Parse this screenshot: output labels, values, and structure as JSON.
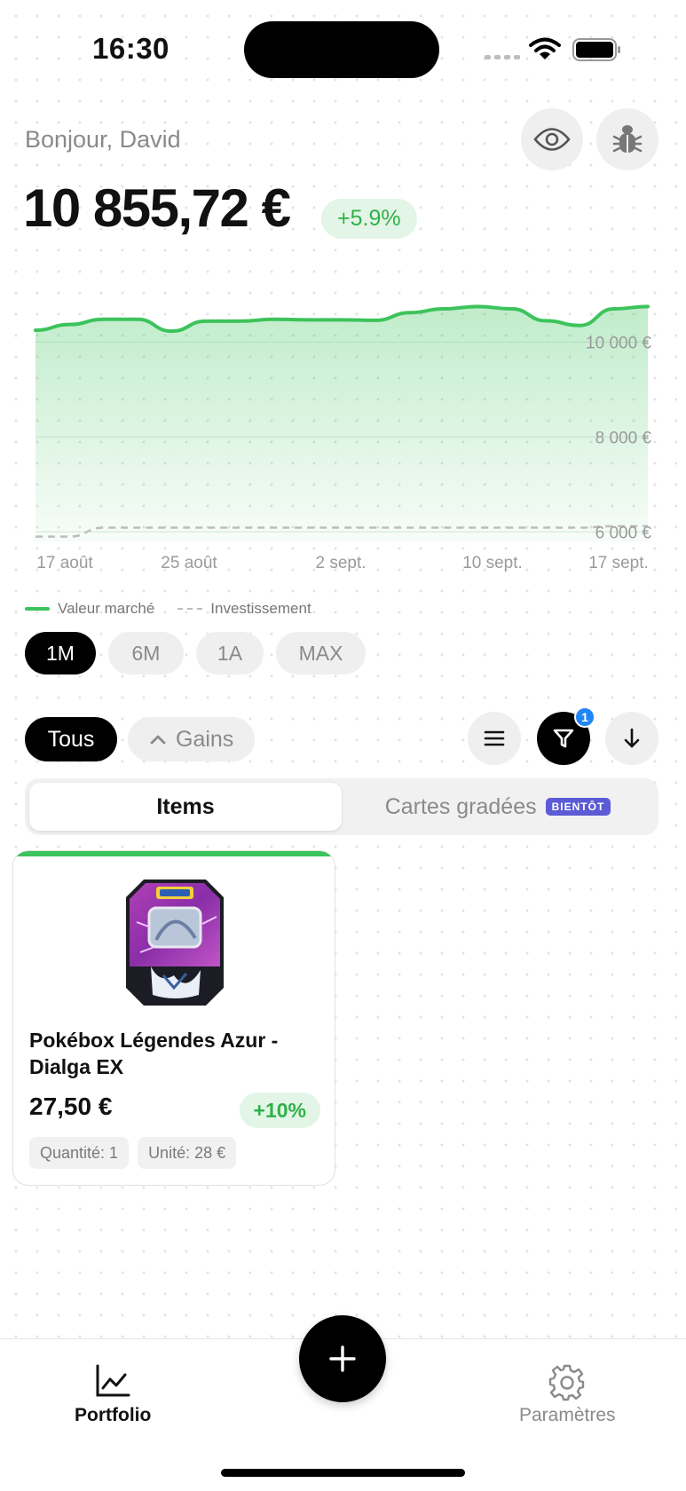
{
  "status_bar": {
    "time": "16:30"
  },
  "header": {
    "greeting": "Bonjour, David",
    "balance": "10 855,72 €",
    "change": "+5.9%"
  },
  "chart_data": {
    "type": "area",
    "x_tick_labels": [
      "17 août",
      "25 août",
      "2 sept.",
      "10 sept.",
      "17 sept."
    ],
    "y_tick_labels": [
      "10 000 €",
      "8 000 €",
      "6 000 €"
    ],
    "y_ticks": [
      10000,
      8000,
      6000
    ],
    "ylim": [
      5800,
      10850
    ],
    "series": [
      {
        "name": "Valeur marché",
        "color": "#3cc35b",
        "values": [
          10250,
          10370,
          10480,
          10480,
          10230,
          10440,
          10440,
          10480,
          10470,
          10470,
          10460,
          10620,
          10700,
          10750,
          10700,
          10450,
          10350,
          10700,
          10750
        ]
      },
      {
        "name": "Investissement",
        "color": "#bdbdbd",
        "dashed": true,
        "values": [
          5900,
          5900,
          6090,
          6090,
          6090,
          6090,
          6090,
          6090,
          6090,
          6090,
          6090,
          6090,
          6090,
          6090,
          6090,
          6090,
          6090,
          6120,
          6120
        ]
      }
    ],
    "grid": true,
    "legend_position": "bottom-left"
  },
  "legend": {
    "market": "Valeur marché",
    "investment": "Investissement"
  },
  "ranges": [
    {
      "label": "1M",
      "active": true
    },
    {
      "label": "6M",
      "active": false
    },
    {
      "label": "1A",
      "active": false
    },
    {
      "label": "MAX",
      "active": false
    }
  ],
  "filters": {
    "all": "Tous",
    "gains": "Gains",
    "filter_count": "1"
  },
  "tabs_segment": {
    "items": "Items",
    "graded": "Cartes gradées",
    "soon": "BIENTÔT"
  },
  "item": {
    "title": "Pokébox Légendes Azur - Dialga EX",
    "price": "27,50 €",
    "gain": "+10%",
    "quantity": "Quantité: 1",
    "unit": "Unité: 28 €"
  },
  "tabbar": {
    "portfolio": "Portfolio",
    "settings": "Paramètres"
  },
  "colors": {
    "accent_green": "#3cc35b",
    "badge_blue": "#1f86f5",
    "soon_purple": "#5b5bd6"
  }
}
